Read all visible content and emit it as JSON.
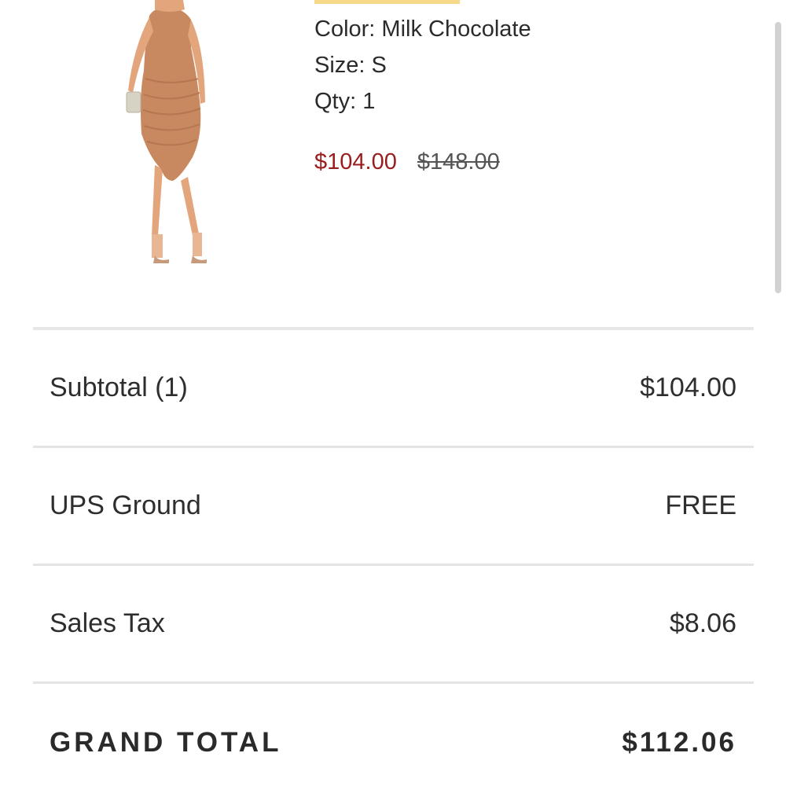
{
  "product": {
    "image_icon": "dress-product-photo",
    "color_line": "Color: Milk Chocolate",
    "size_line": "Size: S",
    "qty_line": "Qty: 1",
    "sale_price": "$104.00",
    "original_price": "$148.00",
    "sale_color": "#9b1c1c"
  },
  "summary": {
    "rows": [
      {
        "label": "Subtotal (1)",
        "value": "$104.00"
      },
      {
        "label": "UPS Ground",
        "value": "FREE"
      },
      {
        "label": "Sales Tax",
        "value": "$8.06"
      }
    ],
    "grand_total": {
      "label": "GRAND TOTAL",
      "value": "$112.06"
    }
  }
}
